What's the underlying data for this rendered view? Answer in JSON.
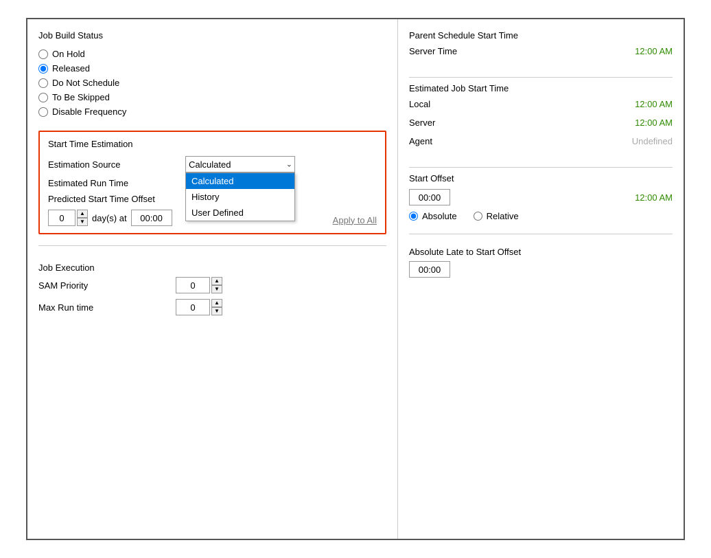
{
  "left": {
    "jobBuildStatus": {
      "title": "Job Build Status",
      "options": [
        {
          "label": "On Hold",
          "value": "on-hold",
          "checked": false
        },
        {
          "label": "Released",
          "value": "released",
          "checked": true
        },
        {
          "label": "Do Not Schedule",
          "value": "do-not-schedule",
          "checked": false
        },
        {
          "label": "To Be Skipped",
          "value": "to-be-skipped",
          "checked": false
        },
        {
          "label": "Disable Frequency",
          "value": "disable-frequency",
          "checked": false
        }
      ]
    },
    "startTimeEstimation": {
      "title": "Start Time Estimation",
      "estimationSourceLabel": "Estimation Source",
      "estimationSourceValue": "Calculated",
      "dropdownOptions": [
        "Calculated",
        "History",
        "User Defined"
      ],
      "estimatedRunTimeLabel": "Estimated Run Time",
      "predictedStartTimeOffsetLabel": "Predicted Start Time Offset",
      "spinnerValue": "0",
      "daysAtLabel": "day(s) at",
      "timeValue": "00:00",
      "applyToAllLabel": "Apply to All"
    },
    "jobExecution": {
      "title": "Job Execution",
      "samPriorityLabel": "SAM Priority",
      "samPriorityValue": "0",
      "maxRunTimeLabel": "Max Run time",
      "maxRunTimeValue": "0"
    }
  },
  "right": {
    "parentSchedule": {
      "title": "Parent Schedule Start Time",
      "serverTimeLabel": "Server Time",
      "serverTimeValue": "12:00 AM"
    },
    "estimatedJobStart": {
      "title": "Estimated Job Start Time",
      "localLabel": "Local",
      "localValue": "12:00 AM",
      "serverLabel": "Server",
      "serverValue": "12:00 AM",
      "agentLabel": "Agent",
      "agentValue": "Undefined"
    },
    "startOffset": {
      "title": "Start Offset",
      "timeValue": "00:00",
      "timeDisplay": "12:00 AM",
      "absoluteLabel": "Absolute",
      "relativeLabel": "Relative"
    },
    "absoluteLate": {
      "title": "Absolute Late to Start Offset",
      "timeValue": "00:00"
    }
  }
}
